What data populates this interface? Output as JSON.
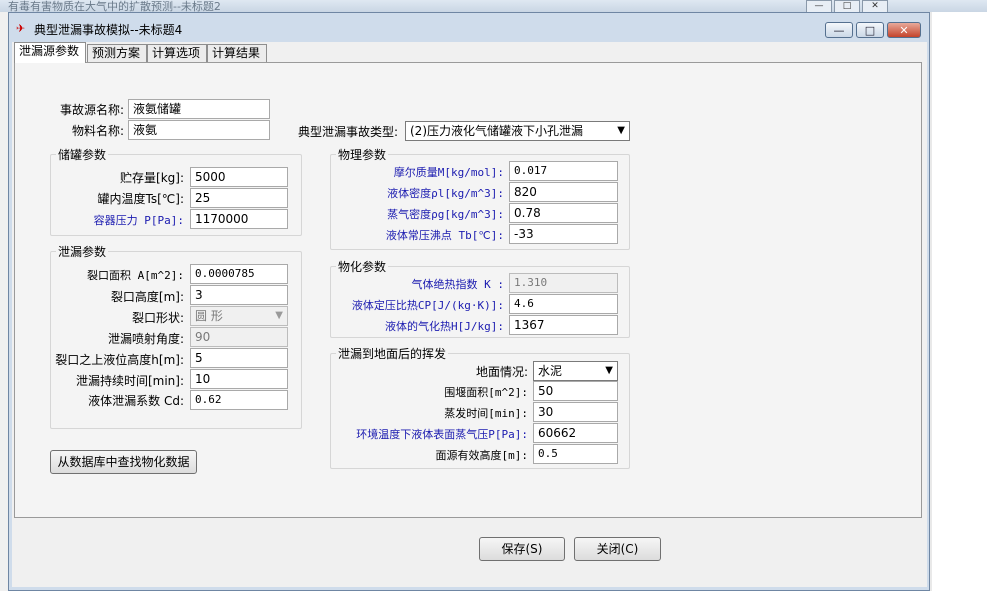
{
  "background_window": {
    "title": "有毒有害物质在大气中的扩散预测--未标题2",
    "controls": [
      "—",
      "□",
      "✕"
    ]
  },
  "dialog": {
    "icon": "✈",
    "title": "典型泄漏事故模拟--未标题4",
    "controls": [
      "—",
      "□",
      "✕"
    ]
  },
  "tabs": [
    "泄漏源参数",
    "预测方案",
    "计算选项",
    "计算结果"
  ],
  "top": {
    "source_name_label": "事故源名称:",
    "source_name_value": "液氨储罐",
    "material_name_label": "物料名称:",
    "material_name_value": "液氨",
    "accident_type_label": "典型泄漏事故类型:",
    "accident_type_value": "(2)压力液化气储罐液下小孔泄漏"
  },
  "tank": {
    "title": "储罐参数",
    "fields": [
      {
        "label": "贮存量[kg]:",
        "value": "5000"
      },
      {
        "label": "罐内温度Ts[℃]:",
        "value": "25"
      },
      {
        "label": "容器压力 P[Pa]:",
        "value": "1170000"
      }
    ]
  },
  "leak": {
    "title": "泄漏参数",
    "fields": [
      {
        "label": "裂口面积 A[m^2]:",
        "value": "0.0000785"
      },
      {
        "label": "裂口高度[m]:",
        "value": "3"
      },
      {
        "label": "裂口形状:",
        "value": "圆  形"
      },
      {
        "label": "泄漏喷射角度:",
        "value": "90"
      },
      {
        "label": "裂口之上液位高度h[m]:",
        "value": "5"
      },
      {
        "label": "泄漏持续时间[min]:",
        "value": "10"
      },
      {
        "label": "液体泄漏系数  Cd:",
        "value": "0.62"
      }
    ]
  },
  "physical": {
    "title": "物理参数",
    "fields": [
      {
        "label": "摩尔质量M[kg/mol]:",
        "value": "0.017"
      },
      {
        "label": "液体密度ρl[kg/m^3]:",
        "value": "820"
      },
      {
        "label": "蒸气密度ρg[kg/m^3]:",
        "value": "0.78"
      },
      {
        "label": "液体常压沸点 Tb[℃]:",
        "value": "-33"
      }
    ]
  },
  "chemical": {
    "title": "物化参数",
    "fields": [
      {
        "label": "气体绝热指数  K :",
        "value": "1.310"
      },
      {
        "label": "液体定压比热CP[J/(kg·K)]:",
        "value": "4.6"
      },
      {
        "label": "液体的气化热H[J/kg]:",
        "value": "1367"
      }
    ]
  },
  "evaporation": {
    "title": "泄漏到地面后的挥发",
    "fields": [
      {
        "label": "地面情况:",
        "value": "水泥"
      },
      {
        "label": "围堰面积[m^2]:",
        "value": "50"
      },
      {
        "label": "蒸发时间[min]:",
        "value": "30"
      },
      {
        "label": "环境温度下液体表面蒸气压P[Pa]:",
        "value": "60662"
      },
      {
        "label": "面源有效高度[m]:",
        "value": "0.5"
      }
    ]
  },
  "buttons": {
    "lookup": "从数据库中查找物化数据",
    "save": "保存(S)",
    "close": "关闭(C)"
  },
  "colors": {
    "label_blue": "#1b1bb0",
    "close_button": "#c4432b"
  }
}
